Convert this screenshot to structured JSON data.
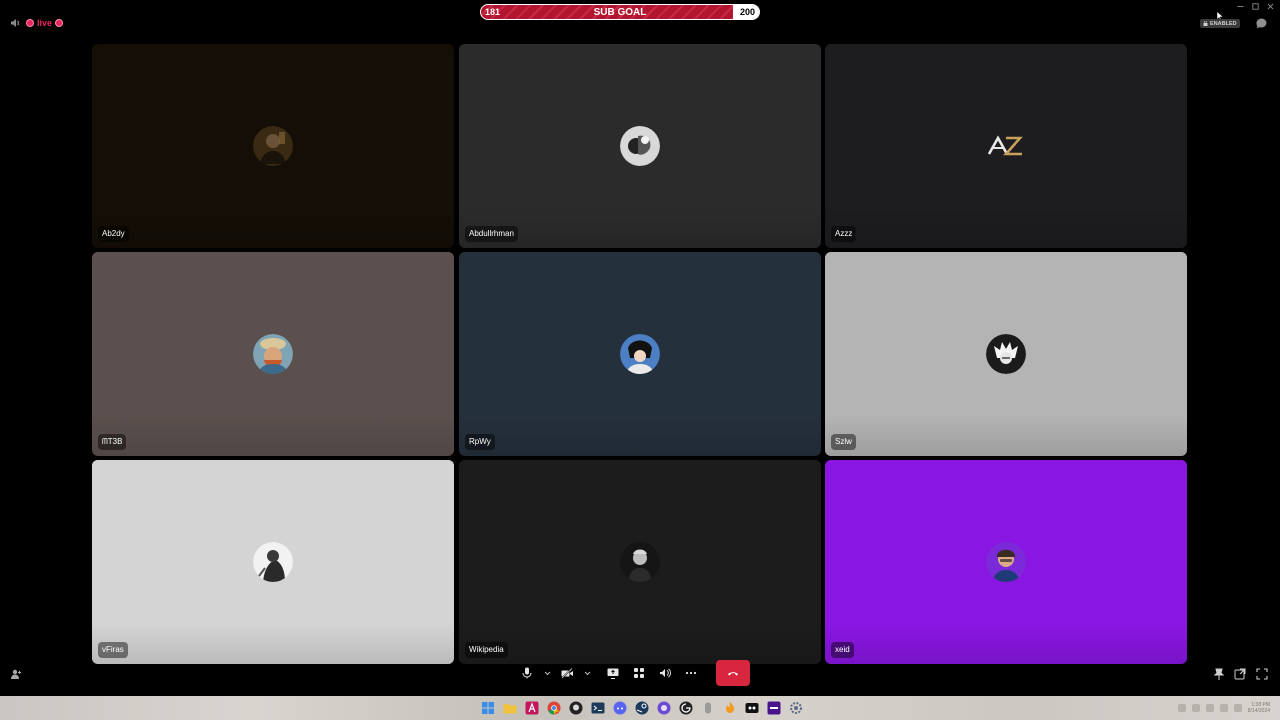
{
  "live": {
    "label": "live"
  },
  "sub_goal": {
    "current": "181",
    "title": "SUB GOAL",
    "target": "200",
    "progress": 0.905
  },
  "header": {
    "enabled_badge": "ENABLED"
  },
  "participants": [
    {
      "name": "Ab2dy",
      "bg": "#140e06"
    },
    {
      "name": "Abdullrhman",
      "bg": "#2b2b2b"
    },
    {
      "name": "Azzz",
      "bg": "#1d1d20"
    },
    {
      "name": "ᗰT3B",
      "bg": "#5b504d"
    },
    {
      "name": "RpWy",
      "bg": "#24303b"
    },
    {
      "name": "Szlw",
      "bg": "#b4b4b4"
    },
    {
      "name": "vFiras",
      "bg": "#d4d4d4",
      "speaking": true
    },
    {
      "name": "Wikipedia",
      "bg": "#1c1c1c"
    },
    {
      "name": "xeid",
      "bg": "#8a16e2"
    }
  ],
  "taskbar": {
    "clock_time": "1:38 PM",
    "clock_date": "8/14/2024"
  }
}
